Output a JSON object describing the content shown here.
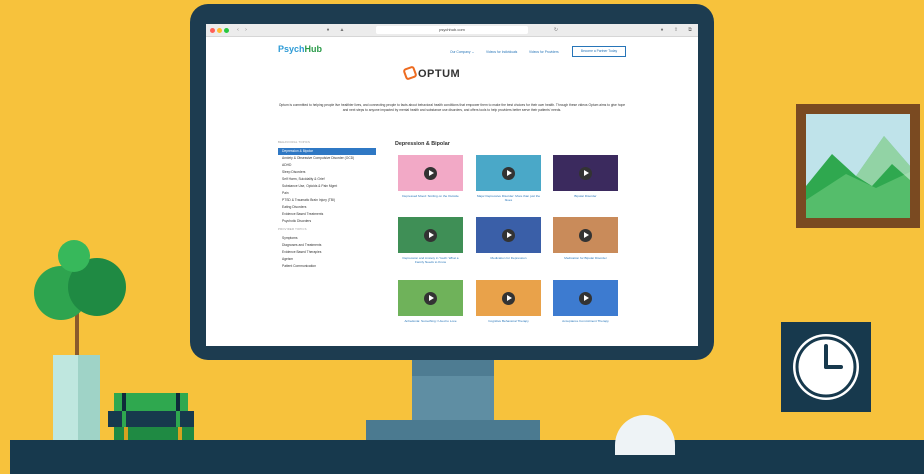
{
  "browser": {
    "url": "psychhub.com"
  },
  "site": {
    "logo_psych": "Psych",
    "logo_hub": "Hub",
    "nav": [
      {
        "label": "Our Company ⌄"
      },
      {
        "label": "Videos for Individuals"
      },
      {
        "label": "Videos for Providers"
      }
    ],
    "partner_button": "Become a Partner Today",
    "partner_name": "OPTUM",
    "intro": "Optum is committed to helping people live healthier lives, and connecting people to facts about behavioral health conditions that empower them to make the best choices for their own health. Through these videos Optum aims to give hope and next steps to anyone impacted by mental health and substance use disorders, and offers tools to help providers better serve their patients' needs."
  },
  "sidebar": {
    "heading1": "BEHAVIORAL TOPICS",
    "topics": [
      {
        "label": "Depression & Bipolar",
        "active": true
      },
      {
        "label": "Anxiety & Obsessive Compulsive Disorder (OCD)"
      },
      {
        "label": "ADHD"
      },
      {
        "label": "Sleep Disorders"
      },
      {
        "label": "Self Harm, Suicidality & Grief"
      },
      {
        "label": "Substance Use, Opioids & Pain Mgmt"
      },
      {
        "label": "Pain"
      },
      {
        "label": "PTSD & Traumatic Brain Injury (TBI)"
      },
      {
        "label": "Eating Disorders"
      },
      {
        "label": "Evidence Based Treatments"
      },
      {
        "label": "Psychotic Disorders"
      }
    ],
    "heading2": "PROVIDER TOPICS",
    "provider_topics": [
      {
        "label": "Symptoms"
      },
      {
        "label": "Diagnoses and Treatments"
      },
      {
        "label": "Evidence Based Therapies"
      },
      {
        "label": "Ageism"
      },
      {
        "label": "Patient Communication"
      }
    ]
  },
  "main": {
    "section_title": "Depression & Bipolar",
    "videos": [
      {
        "caption": "Depressed Mood: Smiling on the Outside",
        "color": "#f2a9c6"
      },
      {
        "caption": "Major Depressive Disorder: More than just the blues",
        "color": "#4aa8c8"
      },
      {
        "caption": "Bipolar Disorder",
        "color": "#3b2a5e"
      },
      {
        "caption": "Depression and Anxiety in Youth: What a Family Needs to Know",
        "color": "#3f8f56"
      },
      {
        "caption": "Medication for Depression",
        "color": "#3a5fa8"
      },
      {
        "caption": "Medication for Bipolar Disorder",
        "color": "#c98b5a"
      },
      {
        "caption": "Anhedonia: Something I Used to Love",
        "color": "#6fb25a"
      },
      {
        "caption": "Cognitive Behavioral Therapy",
        "color": "#e9a24a"
      },
      {
        "caption": "Acceptance Commitment Therapy",
        "color": "#3d7bd0"
      }
    ]
  },
  "colors": {
    "background": "#f7c23c",
    "monitor": "#1d3c50",
    "accent_blue": "#2f78c4",
    "optum_orange": "#ed6b20"
  }
}
